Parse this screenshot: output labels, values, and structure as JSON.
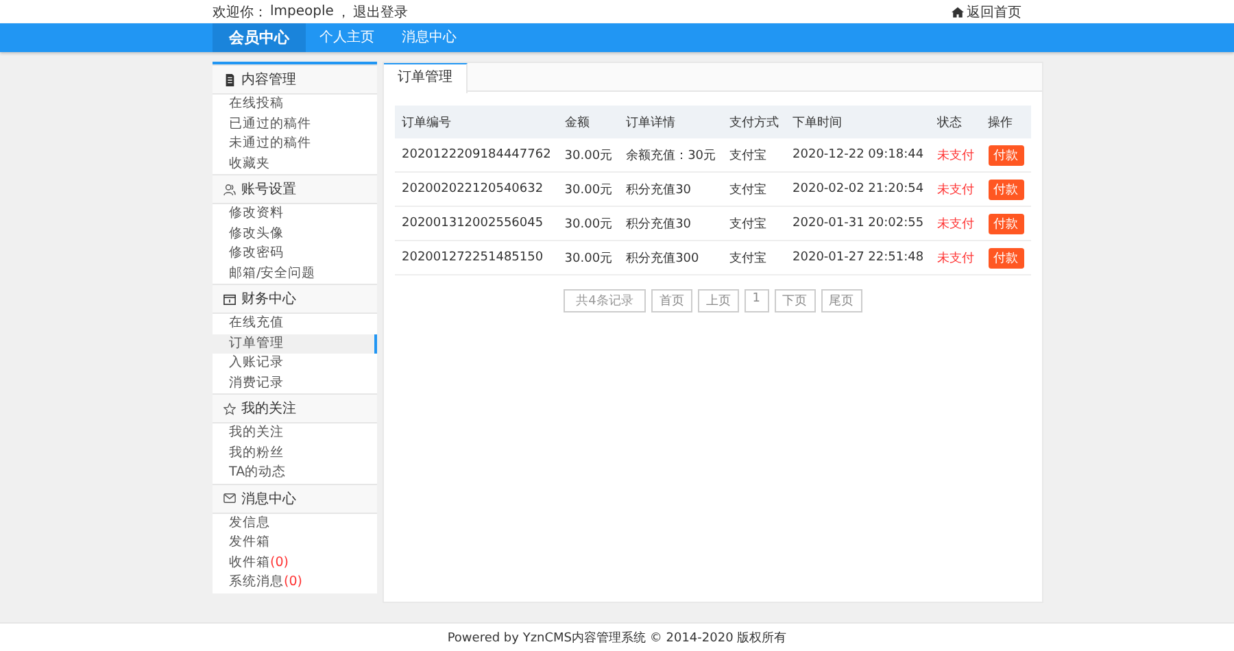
{
  "topbar": {
    "welcome": "欢迎你：",
    "username": "lmpeople",
    "separator": "，",
    "logout": "退出登录",
    "home_link": "返回首页"
  },
  "nav": {
    "items": [
      {
        "label": "会员中心",
        "selected": true
      },
      {
        "label": "个人主页",
        "selected": false
      },
      {
        "label": "消息中心",
        "selected": false
      }
    ]
  },
  "sidebar": {
    "groups": [
      {
        "title": "内容管理",
        "kind": "document",
        "items": [
          {
            "label": "在线投稿",
            "selected": false
          },
          {
            "label": "已通过的稿件",
            "selected": false
          },
          {
            "label": "未通过的稿件",
            "selected": false
          },
          {
            "label": "收藏夹",
            "selected": false
          }
        ]
      },
      {
        "title": "账号设置",
        "kind": "person",
        "items": [
          {
            "label": "修改资料",
            "selected": false
          },
          {
            "label": "修改头像",
            "selected": false
          },
          {
            "label": "修改密码",
            "selected": false
          },
          {
            "label": "邮箱/安全问题",
            "selected": false
          }
        ]
      },
      {
        "title": "财务中心",
        "kind": "wallet",
        "items": [
          {
            "label": "在线充值",
            "selected": false
          },
          {
            "label": "订单管理",
            "selected": true
          },
          {
            "label": "入账记录",
            "selected": false
          },
          {
            "label": "消费记录",
            "selected": false
          }
        ]
      },
      {
        "title": "我的关注",
        "kind": "star",
        "items": [
          {
            "label": "我的关注",
            "selected": false
          },
          {
            "label": "我的粉丝",
            "selected": false
          },
          {
            "label": "TA的动态",
            "selected": false
          }
        ]
      },
      {
        "title": "消息中心",
        "kind": "envelope",
        "items": [
          {
            "label": "发信息",
            "selected": false
          },
          {
            "label": "发件箱",
            "selected": false
          },
          {
            "label": "收件箱",
            "count": "(0)",
            "selected": false
          },
          {
            "label": "系统消息",
            "count": "(0)",
            "selected": false
          }
        ]
      }
    ]
  },
  "main": {
    "tab": "订单管理",
    "table": {
      "columns": [
        "订单编号",
        "金额",
        "订单详情",
        "支付方式",
        "下单时间",
        "状态",
        "操作"
      ],
      "rows": [
        {
          "order_no": "2020122209184447762",
          "amount": "30.00元",
          "detail": "余额充值：30元",
          "payment": "支付宝",
          "time": "2020-12-22 09:18:44",
          "status": "未支付",
          "action": "付款"
        },
        {
          "order_no": "202002022120540632",
          "amount": "30.00元",
          "detail": "积分充值30",
          "payment": "支付宝",
          "time": "2020-02-02 21:20:54",
          "status": "未支付",
          "action": "付款"
        },
        {
          "order_no": "202001312002556045",
          "amount": "30.00元",
          "detail": "积分充值30",
          "payment": "支付宝",
          "time": "2020-01-31 20:02:55",
          "status": "未支付",
          "action": "付款"
        },
        {
          "order_no": "202001272251485150",
          "amount": "30.00元",
          "detail": "积分充值300",
          "payment": "支付宝",
          "time": "2020-01-27 22:51:48",
          "status": "未支付",
          "action": "付款"
        }
      ]
    },
    "pagination": [
      {
        "label": "共4条记录",
        "kind": "info"
      },
      {
        "label": "首页",
        "kind": "button"
      },
      {
        "label": "上页",
        "kind": "button"
      },
      {
        "label": "1",
        "kind": "button"
      },
      {
        "label": "下页",
        "kind": "button"
      },
      {
        "label": "尾页",
        "kind": "button"
      }
    ]
  },
  "footer": "Powered by YznCMS内容管理系统 © 2014-2020 版权所有"
}
